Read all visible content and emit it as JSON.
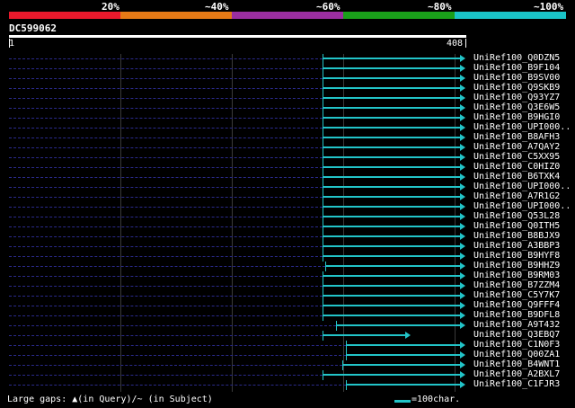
{
  "scale": {
    "labels": [
      "20%",
      "~40%",
      "~60%",
      "~80%",
      "~100%"
    ],
    "colors": [
      "#e8192c",
      "#e57a16",
      "#9a2ea0",
      "#1aa01a",
      "#1ac4c8"
    ]
  },
  "query": {
    "id": "DC599062",
    "start": "1",
    "end": "408",
    "length": 408
  },
  "hits": [
    {
      "name": "UniRef100_Q0DZN5",
      "q_start": 280,
      "q_end": 408
    },
    {
      "name": "UniRef100_B9F104",
      "q_start": 280,
      "q_end": 408
    },
    {
      "name": "UniRef100_B9SV00",
      "q_start": 280,
      "q_end": 408
    },
    {
      "name": "UniRef100_Q9SKB9",
      "q_start": 280,
      "q_end": 408
    },
    {
      "name": "UniRef100_Q93YZ7",
      "q_start": 280,
      "q_end": 408
    },
    {
      "name": "UniRef100_Q3E6W5",
      "q_start": 280,
      "q_end": 408
    },
    {
      "name": "UniRef100_B9HGI0",
      "q_start": 280,
      "q_end": 408
    },
    {
      "name": "UniRef100_UPI000..",
      "q_start": 280,
      "q_end": 408
    },
    {
      "name": "UniRef100_B8AFH3",
      "q_start": 280,
      "q_end": 408
    },
    {
      "name": "UniRef100_A7QAY2",
      "q_start": 280,
      "q_end": 408
    },
    {
      "name": "UniRef100_C5XX95",
      "q_start": 280,
      "q_end": 408
    },
    {
      "name": "UniRef100_C0HIZ0",
      "q_start": 280,
      "q_end": 408
    },
    {
      "name": "UniRef100_B6TXK4",
      "q_start": 280,
      "q_end": 408
    },
    {
      "name": "UniRef100_UPI000..",
      "q_start": 280,
      "q_end": 408
    },
    {
      "name": "UniRef100_A7R1G2",
      "q_start": 280,
      "q_end": 408
    },
    {
      "name": "UniRef100_UPI000..",
      "q_start": 280,
      "q_end": 408
    },
    {
      "name": "UniRef100_Q53L28",
      "q_start": 280,
      "q_end": 408
    },
    {
      "name": "UniRef100_Q0ITH5",
      "q_start": 280,
      "q_end": 408
    },
    {
      "name": "UniRef100_B8BJX9",
      "q_start": 280,
      "q_end": 408
    },
    {
      "name": "UniRef100_A3BBP3",
      "q_start": 280,
      "q_end": 408
    },
    {
      "name": "UniRef100_B9HYF8",
      "q_start": 280,
      "q_end": 408
    },
    {
      "name": "UniRef100_B9HHZ9",
      "q_start": 283,
      "q_end": 408
    },
    {
      "name": "UniRef100_B9RM03",
      "q_start": 280,
      "q_end": 408
    },
    {
      "name": "UniRef100_B7ZZM4",
      "q_start": 280,
      "q_end": 408
    },
    {
      "name": "UniRef100_C5Y7K7",
      "q_start": 280,
      "q_end": 408
    },
    {
      "name": "UniRef100_Q9FFF4",
      "q_start": 280,
      "q_end": 408
    },
    {
      "name": "UniRef100_B9DFL8",
      "q_start": 280,
      "q_end": 408
    },
    {
      "name": "UniRef100_A9T432",
      "q_start": 292,
      "q_end": 408
    },
    {
      "name": "UniRef100_Q3EBQ7",
      "q_start": 280,
      "q_end": 359
    },
    {
      "name": "UniRef100_C1N0F3",
      "q_start": 301,
      "q_end": 408
    },
    {
      "name": "UniRef100_Q00ZA1",
      "q_start": 301,
      "q_end": 408
    },
    {
      "name": "UniRef100_B4WNT1",
      "q_start": 298,
      "q_end": 408
    },
    {
      "name": "UniRef100_A2BXL7",
      "q_start": 280,
      "q_end": 408
    },
    {
      "name": "UniRef100_C1FJR3",
      "q_start": 301,
      "q_end": 408
    }
  ],
  "footer": {
    "large_gaps": "Large gaps: ",
    "tri": "▲",
    "in_query": "(in Query)/",
    "dash": "~",
    "in_subject": " (in Subject)",
    "legend": "=100char."
  },
  "colors": {
    "match": "#22c4c8",
    "background": "#000000"
  }
}
